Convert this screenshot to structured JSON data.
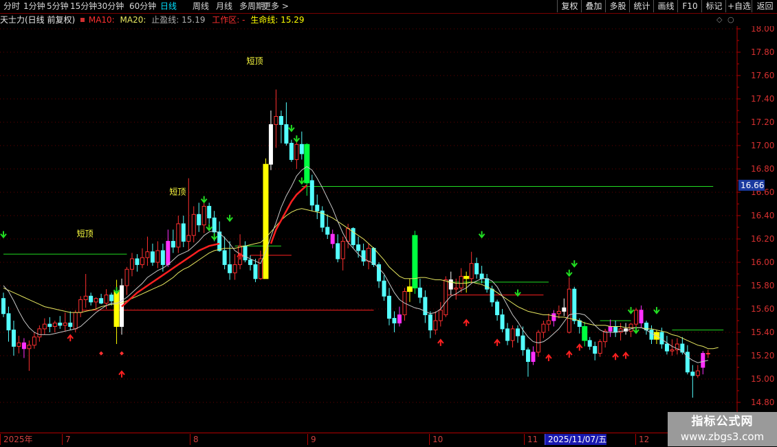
{
  "toolbar": {
    "periods": [
      "分时",
      "1分钟",
      "5分钟",
      "15分钟",
      "30分钟",
      "60分钟",
      "日线",
      "周线",
      "月线",
      "多周期",
      "更多"
    ],
    "active_period": "日线",
    "buttons": [
      "复权",
      "叠加",
      "多股",
      "统计",
      "画线",
      "F10",
      "标记",
      "+自选",
      "返回"
    ]
  },
  "info": {
    "stock": "天士力(日线 前复权)",
    "ma10": "MA10:",
    "ma20": "MA20:",
    "stop_label": "止盈线: 15.19",
    "work_zone": "工作区: -",
    "life_line": "生命线: 15.29"
  },
  "price_axis": {
    "ticks": [
      "18.00",
      "17.80",
      "17.60",
      "17.40",
      "17.20",
      "17.00",
      "16.80",
      "16.60",
      "16.40",
      "16.20",
      "16.00",
      "15.80",
      "15.60",
      "15.40",
      "15.20",
      "15.00",
      "14.80"
    ],
    "current": "16.66"
  },
  "date_axis": {
    "labels": [
      "2025年",
      "7",
      "8",
      "9",
      "10",
      "11",
      "2025/11/07/五",
      "12"
    ],
    "selected": "2025/11/07/五"
  },
  "annotations": {
    "short_top": "短顶"
  },
  "watermark": {
    "line1": "指标公式网",
    "line2": "www.zbgs3.com"
  },
  "colors": {
    "up": "#ff3030",
    "down": "#54ffff",
    "ma10": "#c8c8c8",
    "ma20": "#e8e860",
    "life_line": "#ff2020",
    "arrow_down": "#22dd22",
    "arrow_up": "#ff2020",
    "bull_bar": "#ffff00",
    "bear_bar": "#00ff40",
    "magenta": "#ff30ff"
  },
  "chart_data": {
    "type": "candlestick",
    "y_range": [
      14.75,
      18.05
    ],
    "candles": [
      [
        15.69,
        15.74,
        15.53,
        15.56
      ],
      [
        15.56,
        15.62,
        15.32,
        15.42
      ],
      [
        15.42,
        15.5,
        15.2,
        15.28
      ],
      [
        15.28,
        15.37,
        15.22,
        15.31
      ],
      [
        15.31,
        15.35,
        15.18,
        15.26
      ],
      [
        15.26,
        15.33,
        15.07,
        15.29
      ],
      [
        15.29,
        15.4,
        15.26,
        15.36
      ],
      [
        15.36,
        15.46,
        15.32,
        15.43
      ],
      [
        15.43,
        15.52,
        15.38,
        15.47
      ],
      [
        15.47,
        15.53,
        15.4,
        15.45
      ],
      [
        15.45,
        15.5,
        15.4,
        15.48
      ],
      [
        15.48,
        15.54,
        15.43,
        15.46
      ],
      [
        15.46,
        15.57,
        15.41,
        15.48
      ],
      [
        15.48,
        15.58,
        15.42,
        15.45
      ],
      [
        15.43,
        15.59,
        15.4,
        15.57
      ],
      [
        15.57,
        15.71,
        15.53,
        15.68
      ],
      [
        15.68,
        15.9,
        15.61,
        15.71
      ],
      [
        15.71,
        15.74,
        15.63,
        15.66
      ],
      [
        15.66,
        15.7,
        15.6,
        15.69
      ],
      [
        15.69,
        15.73,
        15.64,
        15.65
      ],
      [
        15.65,
        15.77,
        15.6,
        15.72
      ],
      [
        15.72,
        15.74,
        15.63,
        15.67
      ],
      [
        15.75,
        15.85,
        15.3,
        15.45
      ],
      [
        15.45,
        15.86,
        15.38,
        15.8
      ],
      [
        15.8,
        15.96,
        15.72,
        15.94
      ],
      [
        15.94,
        16.08,
        15.88,
        16.03
      ],
      [
        16.03,
        16.07,
        15.92,
        15.98
      ],
      [
        15.98,
        16.12,
        15.95,
        16.04
      ],
      [
        16.04,
        16.22,
        15.97,
        16.09
      ],
      [
        16.09,
        16.16,
        15.97,
        16.0
      ],
      [
        16.0,
        16.18,
        15.95,
        16.1
      ],
      [
        16.1,
        16.16,
        15.92,
        15.98
      ],
      [
        15.98,
        16.28,
        15.96,
        16.18
      ],
      [
        16.18,
        16.28,
        16.08,
        16.13
      ],
      [
        16.13,
        16.4,
        16.08,
        16.33
      ],
      [
        16.33,
        16.4,
        16.13,
        16.18
      ],
      [
        16.18,
        16.72,
        16.1,
        16.23
      ],
      [
        16.23,
        16.48,
        16.17,
        16.41
      ],
      [
        16.41,
        16.51,
        16.26,
        16.32
      ],
      [
        16.32,
        16.56,
        16.25,
        16.48
      ],
      [
        16.48,
        16.51,
        16.33,
        16.38
      ],
      [
        16.38,
        16.44,
        16.18,
        16.26
      ],
      [
        16.26,
        16.35,
        16.09,
        16.1
      ],
      [
        16.1,
        16.22,
        15.94,
        15.98
      ],
      [
        15.98,
        16.18,
        15.85,
        15.91
      ],
      [
        15.91,
        16.07,
        15.85,
        15.98
      ],
      [
        15.98,
        16.24,
        15.94,
        16.14
      ],
      [
        16.14,
        16.18,
        16.0,
        16.02
      ],
      [
        16.02,
        16.06,
        15.93,
        15.98
      ],
      [
        15.98,
        16.03,
        15.83,
        15.86
      ],
      [
        15.86,
        16.1,
        15.85,
        16.03
      ],
      [
        15.86,
        16.89,
        15.86,
        16.84
      ],
      [
        16.84,
        17.3,
        16.79,
        17.18
      ],
      [
        17.18,
        17.48,
        16.98,
        17.25
      ],
      [
        17.25,
        17.3,
        17.02,
        17.18
      ],
      [
        17.18,
        17.37,
        17.0,
        17.02
      ],
      [
        17.02,
        17.05,
        16.86,
        16.88
      ],
      [
        16.88,
        17.03,
        16.8,
        17.01
      ],
      [
        17.01,
        17.12,
        16.88,
        16.93
      ],
      [
        17.01,
        17.02,
        16.57,
        16.68
      ],
      [
        16.7,
        16.75,
        16.44,
        16.49
      ],
      [
        16.49,
        16.58,
        16.37,
        16.44
      ],
      [
        16.44,
        16.48,
        16.26,
        16.3
      ],
      [
        16.3,
        16.41,
        16.2,
        16.24
      ],
      [
        16.24,
        16.28,
        16.12,
        16.16
      ],
      [
        16.16,
        16.24,
        16.0,
        16.03
      ],
      [
        16.03,
        16.22,
        15.93,
        16.18
      ],
      [
        16.18,
        16.33,
        16.12,
        16.29
      ],
      [
        16.29,
        16.3,
        16.12,
        16.15
      ],
      [
        16.15,
        16.22,
        16.04,
        16.1
      ],
      [
        16.1,
        16.16,
        15.97,
        16.01
      ],
      [
        16.01,
        16.16,
        15.94,
        16.12
      ],
      [
        16.12,
        16.13,
        15.96,
        15.98
      ],
      [
        15.98,
        16.0,
        15.78,
        15.84
      ],
      [
        15.84,
        15.89,
        15.67,
        15.71
      ],
      [
        15.71,
        15.78,
        15.46,
        15.52
      ],
      [
        15.52,
        15.58,
        15.4,
        15.48
      ],
      [
        15.48,
        15.62,
        15.45,
        15.55
      ],
      [
        15.55,
        15.78,
        15.5,
        15.75
      ],
      [
        15.75,
        15.86,
        15.66,
        15.79
      ],
      [
        16.23,
        16.27,
        15.73,
        15.78
      ],
      [
        15.78,
        15.86,
        15.65,
        15.7
      ],
      [
        15.7,
        15.76,
        15.48,
        15.55
      ],
      [
        15.55,
        15.58,
        15.35,
        15.42
      ],
      [
        15.42,
        15.58,
        15.38,
        15.5
      ],
      [
        15.5,
        15.66,
        15.45,
        15.59
      ],
      [
        15.55,
        15.88,
        15.53,
        15.85
      ],
      [
        15.85,
        15.92,
        15.72,
        15.77
      ],
      [
        15.77,
        15.86,
        15.68,
        15.78
      ],
      [
        15.78,
        15.95,
        15.74,
        15.88
      ],
      [
        15.88,
        15.92,
        15.74,
        15.86
      ],
      [
        15.86,
        16.09,
        15.82,
        15.99
      ],
      [
        15.99,
        16.04,
        15.86,
        15.9
      ],
      [
        15.9,
        15.97,
        15.82,
        15.86
      ],
      [
        15.86,
        15.9,
        15.74,
        15.77
      ],
      [
        15.77,
        15.8,
        15.62,
        15.66
      ],
      [
        15.66,
        15.68,
        15.5,
        15.55
      ],
      [
        15.55,
        15.6,
        15.4,
        15.43
      ],
      [
        15.43,
        15.48,
        15.29,
        15.33
      ],
      [
        15.33,
        15.46,
        15.27,
        15.43
      ],
      [
        15.43,
        15.46,
        15.31,
        15.37
      ],
      [
        15.37,
        15.45,
        15.2,
        15.25
      ],
      [
        15.25,
        15.27,
        15.02,
        15.15
      ],
      [
        15.15,
        15.28,
        15.12,
        15.23
      ],
      [
        15.23,
        15.42,
        15.19,
        15.4
      ],
      [
        15.4,
        15.5,
        15.35,
        15.47
      ],
      [
        15.47,
        15.56,
        15.41,
        15.5
      ],
      [
        15.5,
        15.59,
        15.45,
        15.56
      ],
      [
        15.56,
        15.63,
        15.52,
        15.58
      ],
      [
        15.58,
        15.69,
        15.54,
        15.61
      ],
      [
        15.4,
        15.87,
        15.39,
        15.77
      ],
      [
        15.77,
        15.79,
        15.47,
        15.5
      ],
      [
        15.5,
        15.52,
        15.39,
        15.45
      ],
      [
        15.45,
        15.49,
        15.28,
        15.33
      ],
      [
        15.33,
        15.36,
        15.25,
        15.28
      ],
      [
        15.28,
        15.32,
        15.16,
        15.22
      ],
      [
        15.22,
        15.34,
        15.19,
        15.32
      ],
      [
        15.32,
        15.43,
        15.27,
        15.41
      ],
      [
        15.41,
        15.51,
        15.36,
        15.45
      ],
      [
        15.45,
        15.5,
        15.36,
        15.4
      ],
      [
        15.4,
        15.48,
        15.33,
        15.43
      ],
      [
        15.43,
        15.48,
        15.38,
        15.41
      ],
      [
        15.41,
        15.48,
        15.36,
        15.47
      ],
      [
        15.47,
        15.61,
        15.41,
        15.59
      ],
      [
        15.59,
        15.63,
        15.44,
        15.48
      ],
      [
        15.48,
        15.5,
        15.38,
        15.42
      ],
      [
        15.42,
        15.46,
        15.3,
        15.34
      ],
      [
        15.34,
        15.42,
        15.3,
        15.4
      ],
      [
        15.4,
        15.44,
        15.26,
        15.3
      ],
      [
        15.3,
        15.37,
        15.21,
        15.24
      ],
      [
        15.24,
        15.34,
        15.2,
        15.25
      ],
      [
        15.25,
        15.35,
        15.21,
        15.3
      ],
      [
        15.3,
        15.36,
        15.21,
        15.23
      ],
      [
        15.23,
        15.29,
        15.04,
        15.06
      ],
      [
        15.06,
        15.12,
        14.84,
        15.03
      ],
      [
        15.03,
        15.12,
        15.01,
        15.07
      ],
      [
        15.1,
        15.24,
        15.04,
        15.22
      ],
      [
        15.22,
        15.25,
        15.18,
        15.22
      ]
    ],
    "special_bars": {
      "yellow": [
        22,
        51,
        79,
        90,
        127
      ],
      "green": [
        59,
        80,
        113
      ]
    },
    "magenta_bars": [
      4,
      32,
      64,
      77,
      103,
      107,
      118,
      124,
      136
    ],
    "white_bars": [
      23,
      52,
      87,
      109,
      121,
      138
    ],
    "ma10": [
      15.8,
      15.75,
      15.67,
      15.58,
      15.5,
      15.44,
      15.4,
      15.38,
      15.38,
      15.38,
      15.39,
      15.4,
      15.41,
      15.42,
      15.43,
      15.45,
      15.49,
      15.53,
      15.57,
      15.6,
      15.63,
      15.65,
      15.65,
      15.67,
      15.7,
      15.74,
      15.78,
      15.82,
      15.87,
      15.9,
      15.93,
      15.95,
      15.98,
      16.02,
      16.06,
      16.08,
      16.1,
      16.14,
      16.18,
      16.23,
      16.26,
      16.27,
      16.25,
      16.21,
      16.16,
      16.1,
      16.07,
      16.05,
      16.03,
      16.01,
      15.99,
      16.09,
      16.22,
      16.34,
      16.47,
      16.57,
      16.65,
      16.74,
      16.79,
      16.82,
      16.79,
      16.72,
      16.64,
      16.55,
      16.46,
      16.35,
      16.25,
      16.17,
      16.12,
      16.07,
      16.03,
      16.01,
      15.99,
      15.95,
      15.9,
      15.82,
      15.74,
      15.68,
      15.65,
      15.63,
      15.61,
      15.6,
      15.58,
      15.56,
      15.57,
      15.6,
      15.66,
      15.71,
      15.73,
      15.76,
      15.78,
      15.82,
      15.84,
      15.86,
      15.86,
      15.84,
      15.79,
      15.71,
      15.63,
      15.55,
      15.49,
      15.42,
      15.36,
      15.32,
      15.31,
      15.32,
      15.35,
      15.39,
      15.43,
      15.49,
      15.55,
      15.56,
      15.56,
      15.55,
      15.51,
      15.46,
      15.42,
      15.4,
      15.4,
      15.4,
      15.41,
      15.41,
      15.43,
      15.44,
      15.44,
      15.42,
      15.39,
      15.37,
      15.34,
      15.31,
      15.28,
      15.26,
      15.24,
      15.19,
      15.16,
      15.14,
      15.15,
      15.16
    ],
    "ma20": [
      15.78,
      15.76,
      15.74,
      15.72,
      15.7,
      15.68,
      15.66,
      15.64,
      15.62,
      15.61,
      15.6,
      15.59,
      15.58,
      15.57,
      15.57,
      15.57,
      15.58,
      15.59,
      15.6,
      15.62,
      15.63,
      15.64,
      15.64,
      15.65,
      15.67,
      15.69,
      15.71,
      15.73,
      15.75,
      15.77,
      15.79,
      15.81,
      15.84,
      15.87,
      15.91,
      15.94,
      15.96,
      15.99,
      16.02,
      16.05,
      16.08,
      16.1,
      16.11,
      16.12,
      16.12,
      16.12,
      16.13,
      16.14,
      16.15,
      16.16,
      16.17,
      16.21,
      16.26,
      16.31,
      16.36,
      16.4,
      16.43,
      16.45,
      16.46,
      16.45,
      16.44,
      16.43,
      16.42,
      16.4,
      16.38,
      16.35,
      16.32,
      16.29,
      16.26,
      16.23,
      16.2,
      16.16,
      16.12,
      16.07,
      16.02,
      15.96,
      15.92,
      15.88,
      15.86,
      15.86,
      15.86,
      15.87,
      15.87,
      15.86,
      15.85,
      15.85,
      15.84,
      15.83,
      15.82,
      15.82,
      15.82,
      15.83,
      15.82,
      15.81,
      15.79,
      15.77,
      15.74,
      15.71,
      15.68,
      15.65,
      15.62,
      15.6,
      15.58,
      15.57,
      15.56,
      15.55,
      15.55,
      15.54,
      15.53,
      15.53,
      15.52,
      15.51,
      15.5,
      15.48,
      15.47,
      15.46,
      15.46,
      15.46,
      15.45,
      15.45,
      15.45,
      15.44,
      15.44,
      15.44,
      15.44,
      15.43,
      15.43,
      15.42,
      15.41,
      15.4,
      15.38,
      15.37,
      15.35,
      15.33,
      15.31,
      15.29,
      15.28,
      15.26,
      15.26,
      15.27
    ],
    "life_line": {
      "start": 23,
      "values": [
        15.62,
        15.66,
        15.7,
        15.74,
        15.77,
        15.8,
        15.83,
        15.86,
        15.89,
        15.92,
        15.95,
        15.98,
        16.01,
        16.04,
        16.07,
        16.1,
        16.12,
        16.14,
        16.15,
        16.16
      ]
    },
    "life_line2": {
      "start": 52,
      "values": [
        16.16,
        16.28,
        16.36,
        16.44,
        16.52,
        16.58,
        16.62,
        16.66
      ]
    },
    "hlines": [
      {
        "from": 0,
        "to": 24,
        "y": 16.07,
        "color": "#22dd22"
      },
      {
        "from": 15,
        "to": 72,
        "y": 15.59,
        "color": "#ff2020"
      },
      {
        "from": 73,
        "to": 138,
        "y": 16.65,
        "color": "#22dd22",
        "clip": [
          58,
          138
        ]
      },
      {
        "from": 86,
        "to": 106,
        "y": 15.83,
        "color": "#22dd22"
      },
      {
        "from": 86,
        "to": 105,
        "y": 15.72,
        "color": "#ff2020"
      },
      {
        "from": 48,
        "to": 56,
        "y": 16.06,
        "color": "#ff2020"
      },
      {
        "from": 45,
        "to": 54,
        "y": 16.14,
        "color": "#22dd22"
      },
      {
        "from": 116,
        "to": 122,
        "y": 15.5,
        "color": "#22dd22"
      },
      {
        "from": 130,
        "to": 140,
        "y": 15.42,
        "color": "#22dd22"
      }
    ],
    "arrows_down": [
      [
        0,
        16.22
      ],
      [
        22,
        15.74
      ],
      [
        39,
        16.52
      ],
      [
        40,
        16.28
      ],
      [
        41,
        16.2
      ],
      [
        44,
        16.36
      ],
      [
        56,
        17.13
      ],
      [
        57,
        17.04
      ],
      [
        58,
        16.68
      ],
      [
        93,
        16.22
      ],
      [
        100,
        15.72
      ],
      [
        110,
        15.89
      ],
      [
        111,
        15.97
      ],
      [
        122,
        15.57
      ],
      [
        123,
        15.4
      ],
      [
        127,
        15.57
      ]
    ],
    "arrows_up": [
      [
        13,
        15.37
      ],
      [
        23,
        15.06
      ],
      [
        46,
        16.07
      ],
      [
        85,
        15.33
      ],
      [
        90,
        15.5
      ],
      [
        96,
        15.33
      ],
      [
        106,
        15.2
      ],
      [
        110,
        15.23
      ],
      [
        112,
        15.29
      ],
      [
        119,
        15.21
      ],
      [
        121,
        15.22
      ]
    ],
    "red_diamonds": [
      [
        19,
        15.22
      ],
      [
        23,
        15.22
      ]
    ],
    "short_tops": [
      [
        16,
        16.22
      ],
      [
        34,
        16.58
      ],
      [
        49,
        17.7
      ]
    ]
  }
}
